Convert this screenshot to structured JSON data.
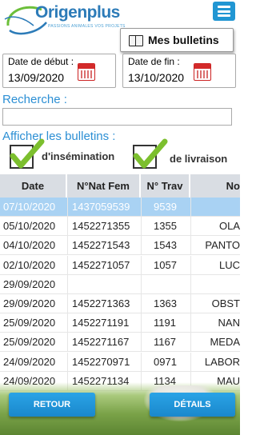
{
  "header": {
    "logo_name": "Origenplus",
    "logo_tagline": "PASSIONS ANIMALES VOS PROJETS",
    "menu_icon": "hamburger-menu-icon",
    "bulletins_button_label": "Mes bulletins",
    "bulletins_icon": "book-icon"
  },
  "filters": {
    "date_debut_label": "Date de début :",
    "date_debut_value": "13/09/2020",
    "date_fin_label": "Date de fin :",
    "date_fin_value": "13/10/2020",
    "calendar_icon": "calendar-icon",
    "recherche_label": "Recherche :",
    "recherche_value": "",
    "afficher_label": "Afficher les bulletins :",
    "insemination_label": "d'insémination",
    "insemination_checked": true,
    "livraison_label": "de livraison",
    "livraison_checked": true
  },
  "table": {
    "headers": [
      "Date",
      "N°Nat Fem",
      "N° Trav",
      "No"
    ],
    "rows": [
      {
        "date": "07/10/2020",
        "nat": "1437059539",
        "trav": "9539",
        "name": "",
        "selected": true
      },
      {
        "date": "05/10/2020",
        "nat": "1452271355",
        "trav": "1355",
        "name": "OLA",
        "selected": false
      },
      {
        "date": "04/10/2020",
        "nat": "1452271543",
        "trav": "1543",
        "name": "PANTO",
        "selected": false
      },
      {
        "date": "02/10/2020",
        "nat": "1452271057",
        "trav": "1057",
        "name": "LUC",
        "selected": false
      },
      {
        "date": "29/09/2020",
        "nat": "",
        "trav": "",
        "name": "",
        "selected": false
      },
      {
        "date": "29/09/2020",
        "nat": "1452271363",
        "trav": "1363",
        "name": "OBST",
        "selected": false
      },
      {
        "date": "25/09/2020",
        "nat": "1452271191",
        "trav": "1191",
        "name": "NAN",
        "selected": false
      },
      {
        "date": "25/09/2020",
        "nat": "1452271167",
        "trav": "1167",
        "name": "MEDA",
        "selected": false
      },
      {
        "date": "24/09/2020",
        "nat": "1452270971",
        "trav": "0971",
        "name": "LABOR",
        "selected": false
      },
      {
        "date": "24/09/2020",
        "nat": "1452271134",
        "trav": "1134",
        "name": "MAU",
        "selected": false
      }
    ]
  },
  "footer": {
    "retour_label": "RETOUR",
    "details_label": "DÉTAILS"
  },
  "colors": {
    "accent": "#2196d3",
    "label_blue": "#2c8fd4",
    "selected_row": "#a9d2f3",
    "check_green": "#7cbf2e"
  }
}
